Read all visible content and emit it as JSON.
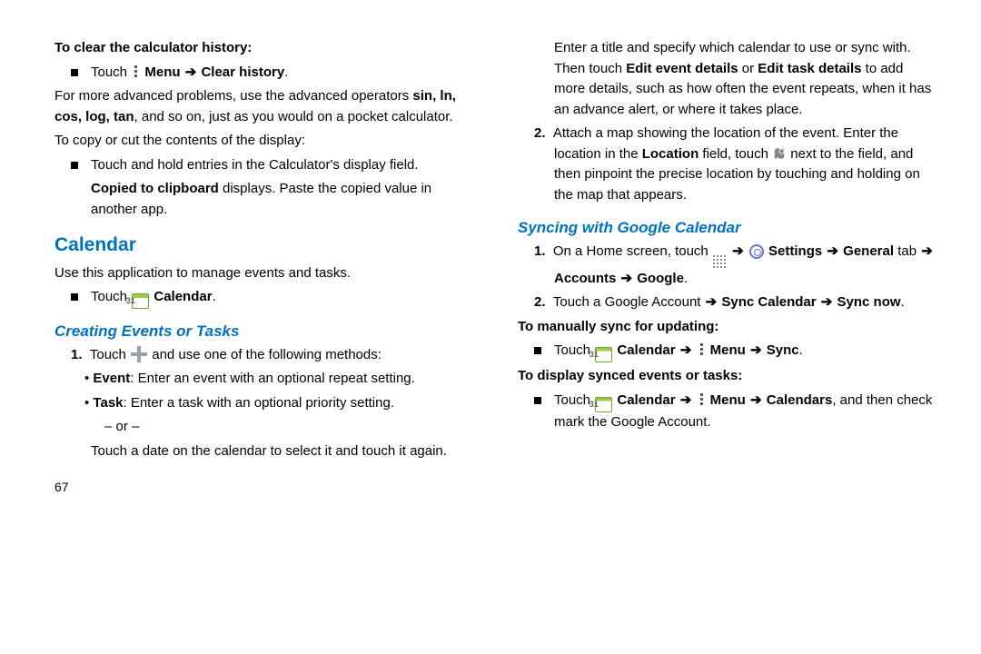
{
  "left": {
    "h_clear": "To clear the calculator history:",
    "bullet_touch": "Touch",
    "menu_clear": "Menu",
    "clear_hist": "Clear history",
    "advanced_line1": "For more advanced problems, use the advanced operators",
    "ops": "sin, ln, cos, log, tan",
    "advanced_line2": ", and so on, just as you would on a pocket calculator.",
    "copy_cut": "To copy or cut the contents of the display:",
    "touch_hold": "Touch and hold entries in the Calculator's display field.",
    "copied": "Copied to clipboard",
    "copied_rest": " displays. Paste the copied value in another app.",
    "calendar_h": "Calendar",
    "cal_intro": "Use this application to manage events and tasks.",
    "touch2": "Touch",
    "cal_label": "Calendar",
    "create_h": "Creating Events or Tasks",
    "step1": "Touch",
    "step1b": "and use one of the following methods:",
    "event_b": "Event",
    "event_t": ": Enter an event with an optional repeat setting.",
    "task_b": "Task",
    "task_t": ": Enter a task with an optional priority setting.",
    "or": "– or –",
    "touch_date": "Touch a date on the calendar to select it and touch it again.",
    "page": "67"
  },
  "right": {
    "para1a": "Enter a title and specify which calendar to use or sync with. Then touch ",
    "edit_event": "Edit event details",
    "or_w": " or ",
    "edit_task": "Edit task details",
    "para1b": " to add more details, such as how often the event repeats, when it has an advance alert, or where it takes place.",
    "step2": "2.",
    "para2a": "Attach a map showing the location of the event. Enter the location in the ",
    "location_b": "Location",
    "para2b": " field, touch ",
    "para2c": " next to the field, and then pinpoint the precise location by touching and holding on the map that appears.",
    "sync_h": "Syncing with Google Calendar",
    "s1": "1.",
    "s1_touch": "On a Home screen, touch",
    "settings": "Settings",
    "general": "General",
    "tab_w": " tab ",
    "accounts": "Accounts",
    "google": "Google",
    "s2": "2.",
    "s2a": "Touch a Google Account ",
    "sync_cal": "Sync Calendar",
    "sync_now": "Sync now",
    "manual_h": "To manually sync for updating:",
    "m_touch": "Touch",
    "cal_l": "Calendar",
    "menu_l": "Menu",
    "sync_l": "Sync",
    "display_h": "To display synced events or tasks:",
    "d_touch": "Touch",
    "calendars_l": "Calendars",
    "d_rest": ", and then check mark the Google Account."
  }
}
